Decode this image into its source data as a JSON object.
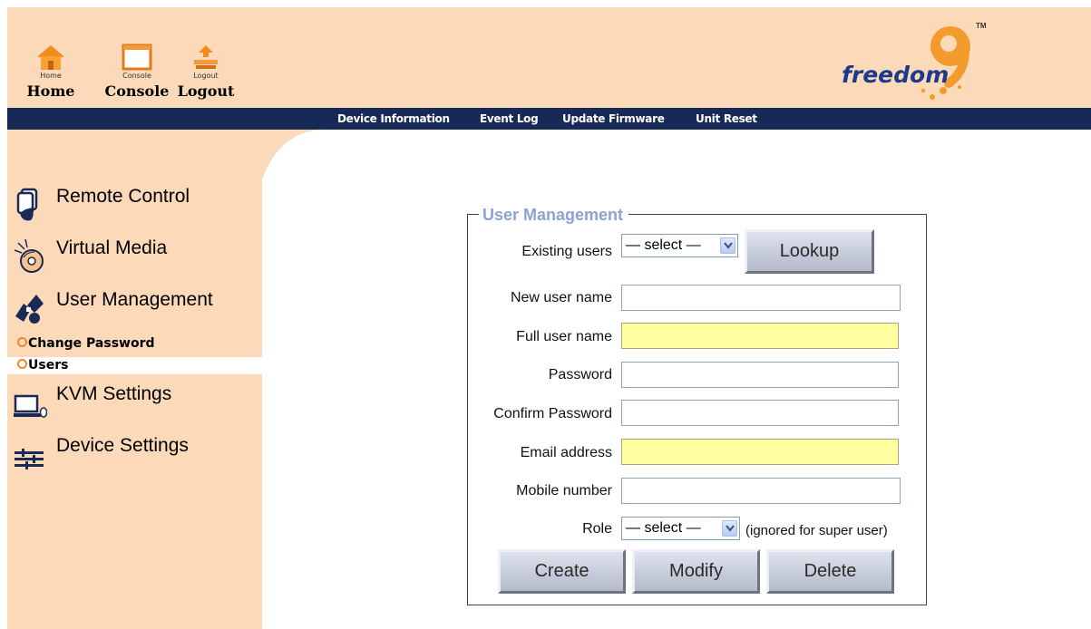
{
  "header": {
    "buttons": [
      {
        "small": "Home",
        "label": "Home"
      },
      {
        "small": "Console",
        "label": "Console"
      },
      {
        "small": "Logout",
        "label": "Logout"
      }
    ],
    "logo_text": "freedom",
    "logo_digit": "9",
    "logo_tm": "TM"
  },
  "nav": {
    "links": [
      "Device Information",
      "Event Log",
      "Update Firmware",
      "Unit Reset"
    ]
  },
  "sidebar": {
    "items": [
      {
        "label": "Remote Control",
        "icon": "remote-control-icon"
      },
      {
        "label": "Virtual Media",
        "icon": "virtual-media-icon"
      },
      {
        "label": "User Management",
        "icon": "user-management-icon"
      },
      {
        "label": "KVM Settings",
        "icon": "kvm-settings-icon"
      },
      {
        "label": "Device Settings",
        "icon": "device-settings-icon"
      }
    ],
    "subitems": [
      {
        "label": "Change Password",
        "active": false
      },
      {
        "label": "Users",
        "active": true
      }
    ]
  },
  "form": {
    "legend": "User Management",
    "existing_users_label": "Existing users",
    "existing_users_value": "— select —",
    "lookup_button": "Lookup",
    "new_user_label": "New user name",
    "new_user_value": "",
    "full_name_label": "Full user name",
    "full_name_value": "",
    "password_label": "Password",
    "password_value": "",
    "confirm_password_label": "Confirm Password",
    "confirm_password_value": "",
    "email_label": "Email address",
    "email_value": "",
    "mobile_label": "Mobile number",
    "mobile_value": "",
    "role_label": "Role",
    "role_value": "— select —",
    "role_hint": "(ignored for super user)",
    "create_button": "Create",
    "modify_button": "Modify",
    "delete_button": "Delete"
  },
  "colors": {
    "header_bg": "#fcd9b8",
    "nav_bg": "#172a57",
    "legend": "#8aa3d6",
    "required_field": "#ffffa0",
    "accent_orange": "#f08a24"
  }
}
